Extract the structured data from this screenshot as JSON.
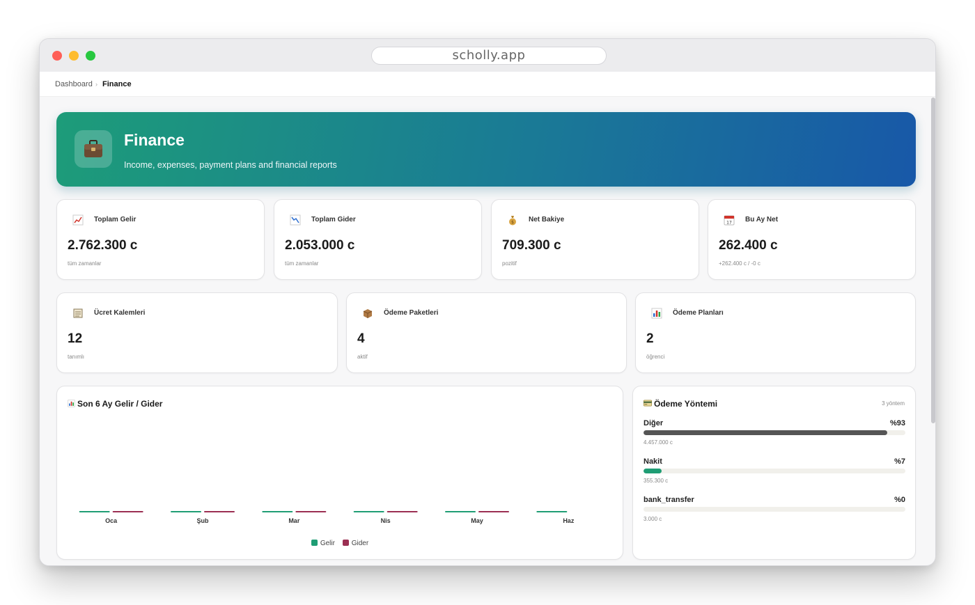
{
  "browser": {
    "url": "scholly.app"
  },
  "breadcrumb": {
    "home": "Dashboard",
    "separator": "›",
    "current": "Finance"
  },
  "hero": {
    "title": "Finance",
    "subtitle": "Income, expenses, payment plans and financial reports",
    "icon": "briefcase-icon"
  },
  "stats_row1": [
    {
      "icon": "chart-up-icon",
      "label": "Toplam Gelir",
      "value": "2.762.300 c",
      "sub": "tüm zamanlar"
    },
    {
      "icon": "chart-down-icon",
      "label": "Toplam Gider",
      "value": "2.053.000 c",
      "sub": "tüm zamanlar"
    },
    {
      "icon": "money-bag-icon",
      "label": "Net Bakiye",
      "value": "709.300 c",
      "sub": "pozitif"
    },
    {
      "icon": "calendar-icon",
      "label": "Bu Ay Net",
      "value": "262.400 c",
      "sub": "+262.400 c / -0 c"
    }
  ],
  "stats_row2": [
    {
      "icon": "ledger-icon",
      "label": "Ücret Kalemleri",
      "value": "12",
      "sub": "tanımlı"
    },
    {
      "icon": "package-icon",
      "label": "Ödeme Paketleri",
      "value": "4",
      "sub": "aktif"
    },
    {
      "icon": "bar-chart-icon",
      "label": "Ödeme Planları",
      "value": "2",
      "sub": "öğrenci"
    }
  ],
  "chart_section": {
    "icon": "bar-chart-icon",
    "title": "Son 6 Ay Gelir / Gider"
  },
  "chart_data": {
    "type": "bar",
    "categories": [
      "Oca",
      "Şub",
      "Mar",
      "Nis",
      "May",
      "Haz"
    ],
    "series": [
      {
        "name": "Gelir",
        "color": "#1f9d74",
        "values": [
          0,
          0,
          0,
          0,
          0,
          0
        ]
      },
      {
        "name": "Gider",
        "color": "#9b2f52",
        "values": [
          0,
          0,
          0,
          0,
          0,
          null
        ]
      }
    ],
    "title": "Son 6 Ay Gelir / Gider",
    "legend": "bottom-center"
  },
  "payment_methods": {
    "icon": "credit-card-icon",
    "title": "Ödeme Yöntemi",
    "count_label": "3 yöntem",
    "items": [
      {
        "name": "Diğer",
        "percent_label": "%93",
        "amount": "4.457.000 c",
        "fraction": 0.93,
        "color": "#555555"
      },
      {
        "name": "Nakit",
        "percent_label": "%7",
        "amount": "355.300 c",
        "fraction": 0.07,
        "color": "#1f9d74"
      },
      {
        "name": "bank_transfer",
        "percent_label": "%0",
        "amount": "3.000 c",
        "fraction": 0.0,
        "color": "#1f9d74"
      }
    ]
  }
}
